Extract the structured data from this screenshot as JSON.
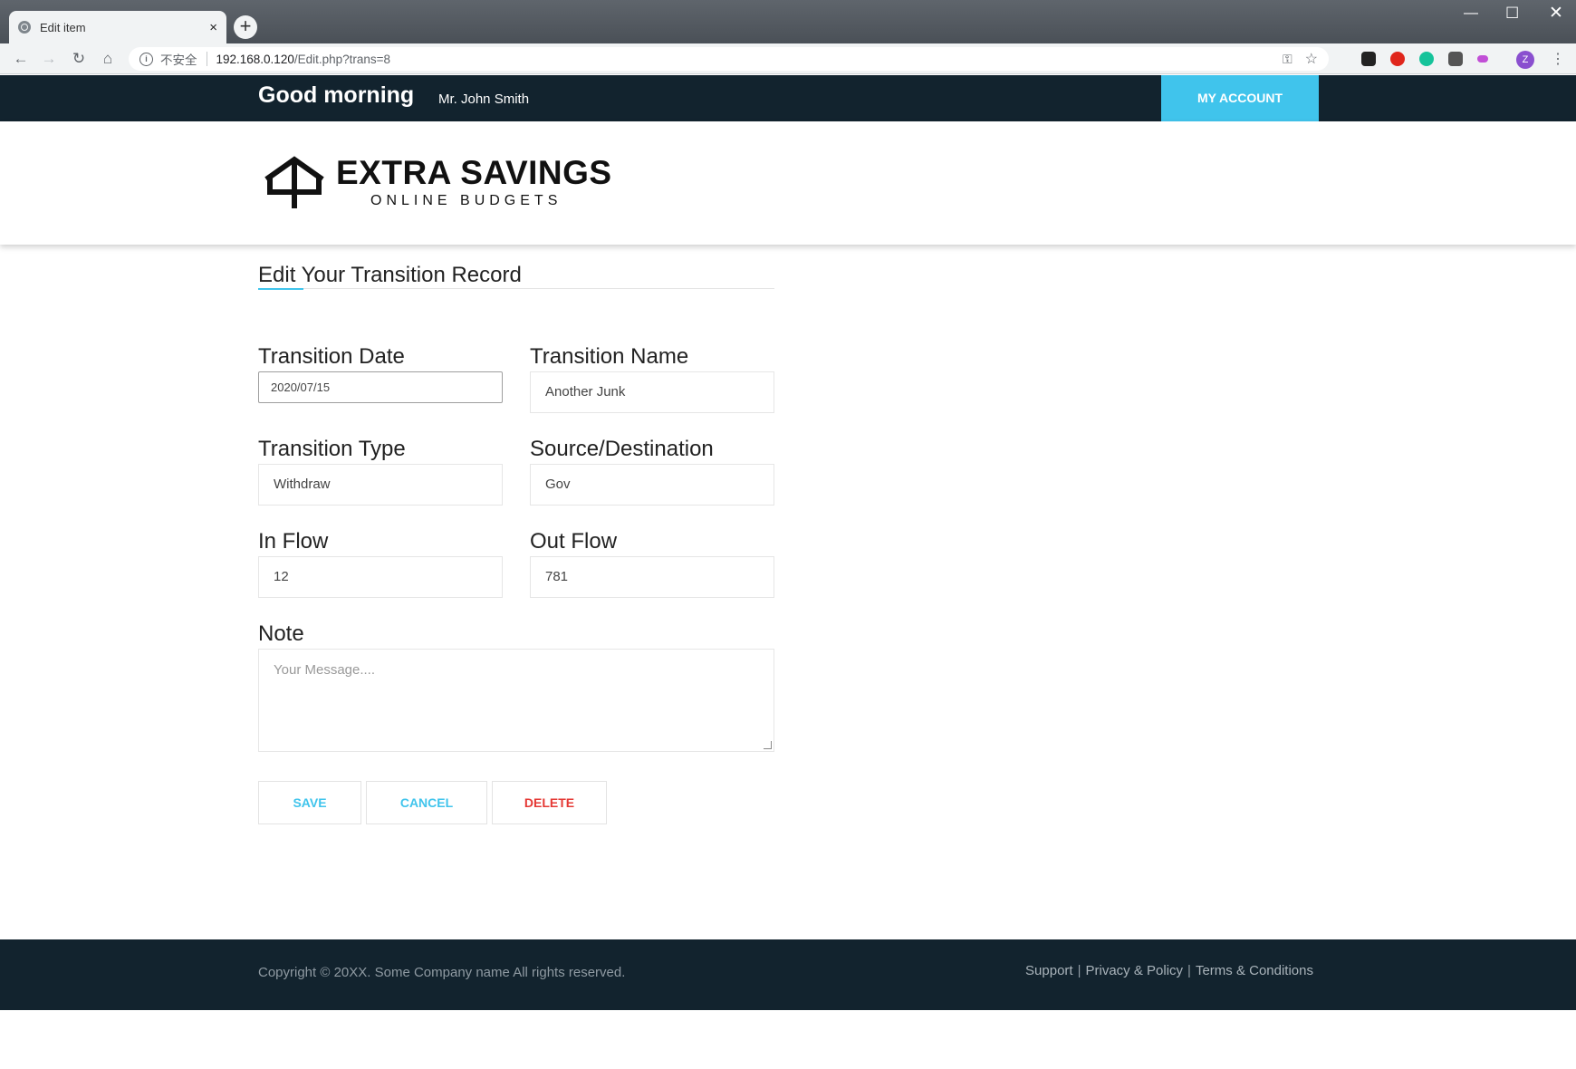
{
  "browser": {
    "tab_title": "Edit item",
    "tab_close": "×",
    "new_tab": "+",
    "security_label": "不安全",
    "url_host": "192.168.0.120",
    "url_path": "/Edit.php?trans=8",
    "avatar_initial": "Z"
  },
  "header": {
    "greeting": "Good morning",
    "user_name": "Mr. John Smith",
    "account_button": "MY ACCOUNT"
  },
  "brand": {
    "name": "EXTRA SAVINGS",
    "tagline": "ONLINE BUDGETS"
  },
  "form": {
    "title": "Edit Your Transition Record",
    "fields": {
      "date": {
        "label": "Transition Date",
        "value": "2020/07/15"
      },
      "name": {
        "label": "Transition Name",
        "value": "Another Junk"
      },
      "type": {
        "label": "Transition Type",
        "value": "Withdraw"
      },
      "source": {
        "label": "Source/Destination",
        "value": "Gov"
      },
      "inflow": {
        "label": "In Flow",
        "value": "12"
      },
      "outflow": {
        "label": "Out Flow",
        "value": "781"
      },
      "note": {
        "label": "Note",
        "placeholder": "Your Message...."
      }
    },
    "buttons": {
      "save": "SAVE",
      "cancel": "CANCEL",
      "delete": "DELETE"
    }
  },
  "footer": {
    "copyright": "Copyright © 20XX. Some Company name All rights reserved.",
    "links": [
      "Support",
      "Privacy & Policy",
      "Terms & Conditions"
    ]
  },
  "colors": {
    "header_bg": "#12232e",
    "accent": "#40c4ec",
    "danger": "#e53935"
  }
}
